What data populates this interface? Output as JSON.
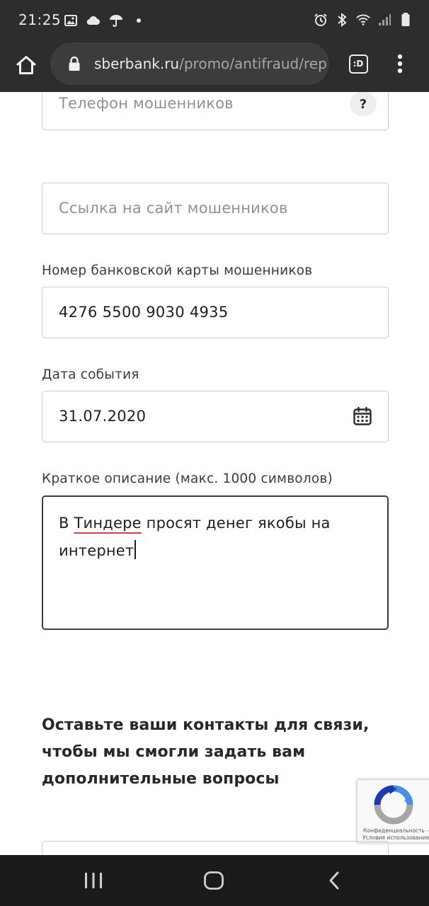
{
  "status_bar": {
    "time": "21:25",
    "left_icons": [
      "image-icon",
      "cloud-icon",
      "umbrella-icon",
      "dot-icon"
    ],
    "right_icons": [
      "alarm-icon",
      "bluetooth-icon",
      "wifi-icon",
      "signal-icon",
      "battery-icon"
    ]
  },
  "browser": {
    "url_domain": "sberbank.ru",
    "url_path": "/promo/antifraud/rep",
    "tabs_badge": ":D"
  },
  "form": {
    "phone_placeholder": "Телефон мошенников",
    "help_label": "?",
    "site_placeholder": "Ссылка на сайт мошенников",
    "card_label": "Номер банковской карты мошенников",
    "card_value": "4276 5500 9030 4935",
    "date_label": "Дата события",
    "date_value": "31.07.2020",
    "description_label": "Краткое описание (макс. 1000 символов)",
    "description_value_prefix": "В ",
    "description_value_misspelled": "Тиндере",
    "description_value_suffix": " просят денег якобы на интернет"
  },
  "contacts_section": {
    "title": "Оставьте ваши контакты для связи, чтобы мы смогли задать вам дополнительные вопросы"
  },
  "recaptcha": {
    "line1": "Конфиденциальность -",
    "line2": "Условия использования"
  },
  "colors": {
    "chrome_bar": "#2d2d2d",
    "nav_bar": "#1b1b1b",
    "spell_underline": "#e23b3b",
    "field_border": "#c9cbce"
  }
}
